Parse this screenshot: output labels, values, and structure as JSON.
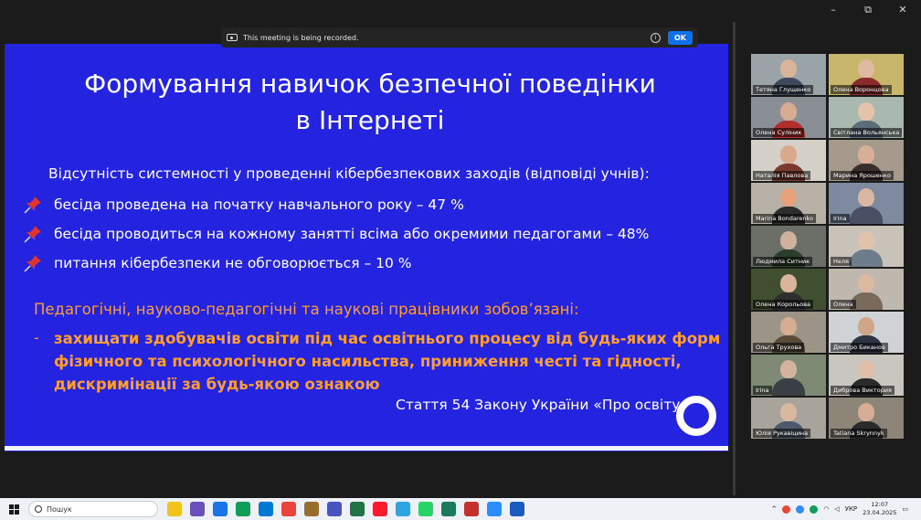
{
  "recording_banner": {
    "message": "This meeting is being recorded.",
    "ok_label": "OK"
  },
  "window_controls": {
    "minimize": "–",
    "restore": "⧉",
    "close": "✕"
  },
  "slide": {
    "title_line1": "Формування навичок безпечної поведінки",
    "title_line2": "в Інтернеті",
    "stat_heading": "Відсутність системності у проведенні кібербезпекових заходів (відповіді учнів):",
    "bullets": [
      "бесіда проведена на початку навчального року – 47 %",
      "бесіда проводиться на кожному занятті всіма або окремими педагогами – 48%",
      "питання кібербезпеки не обговорюється – 10 %"
    ],
    "orange_heading": "Педагогічні, науково-педагогічні та наукові працівники зобов’язані:",
    "dash": "-",
    "orange_body": "захищати здобувачів освіти під час освітнього процесу від будь-яких форм фізичного та психологічного насильства, приниження честі та гідності, дискримінації за будь-якою ознакою",
    "citation": "Стаття 54 Закону України «Про освіту»"
  },
  "participants": [
    {
      "name": "Тетяна Глущенко",
      "bg": "#9aa3a8",
      "skin": "#d9b49a",
      "shirt": "#3d4a5c"
    },
    {
      "name": "Олена Воронцова",
      "bg": "#c8b76a",
      "skin": "#e0b9a0",
      "shirt": "#8a2a2a"
    },
    {
      "name": "Олена Суліник",
      "bg": "#8a8f96",
      "skin": "#d7ab92",
      "shirt": "#b03030"
    },
    {
      "name": "Світлана Вольянська",
      "bg": "#a9b9b0",
      "skin": "#e5c2aa",
      "shirt": "#5b6c7a"
    },
    {
      "name": "Наталія Павлова",
      "bg": "#d4d0c8",
      "skin": "#d9a98e",
      "shirt": "#7a3b2e"
    },
    {
      "name": "Марина Ярошенко",
      "bg": "#a69a8c",
      "skin": "#d8b098",
      "shirt": "#3a2d2d"
    },
    {
      "name": "Marina Bondarenko",
      "bg": "#b7b0a6",
      "skin": "#e6a27a",
      "shirt": "#2d2d2d"
    },
    {
      "name": "Irina",
      "bg": "#7d8aa0",
      "skin": "#d9b7a3",
      "shirt": "#4a4f63"
    },
    {
      "name": "Людмила Ситник",
      "bg": "#6b6f68",
      "skin": "#cfb19d",
      "shirt": "#2c3d2c"
    },
    {
      "name": "Неля",
      "bg": "#c9c2b8",
      "skin": "#e3c2ab",
      "shirt": "#6d7c8a"
    },
    {
      "name": "Олена Корольова",
      "bg": "#3f4f2f",
      "skin": "#d9b59c",
      "shirt": "#2f2f2f"
    },
    {
      "name": "Олена",
      "bg": "#bfb8ae",
      "skin": "#dcb9a1",
      "shirt": "#7a6a5a"
    },
    {
      "name": "Ольга Трухова",
      "bg": "#9d9488",
      "skin": "#d5ad92",
      "shirt": "#5a4a3a"
    },
    {
      "name": "Дмитро Биканов",
      "bg": "#cfd3d6",
      "skin": "#d1a58a",
      "shirt": "#2d3340"
    },
    {
      "name": "Irina",
      "bg": "#7e8a73",
      "skin": "#d4b39d",
      "shirt": "#3a3f45"
    },
    {
      "name": "Диброва Виктория",
      "bg": "#c9c6c0",
      "skin": "#e0bfa9",
      "shirt": "#2a2a2a"
    },
    {
      "name": "Юлія Рукавіцина",
      "bg": "#a8a39b",
      "skin": "#d9b8a0",
      "shirt": "#4d5a6b"
    },
    {
      "name": "Tatiana Skrynnyk",
      "bg": "#8e8579",
      "skin": "#d6ad95",
      "shirt": "#2b2b2b"
    }
  ],
  "taskbar": {
    "search_placeholder": "Пошук",
    "apps": [
      "#f0c419",
      "#6b4fbb",
      "#1a73e8",
      "#0f9d58",
      "#0078d4",
      "#e8453c",
      "#9a6b2e",
      "#4b53bc",
      "#217346",
      "#ff1b2d",
      "#2ca5e0",
      "#25d366",
      "#1c7a5c",
      "#c4302b",
      "#2d8cff",
      "#185abd"
    ],
    "language": "УКР",
    "time": "12:07",
    "date": "23.04.2025"
  }
}
